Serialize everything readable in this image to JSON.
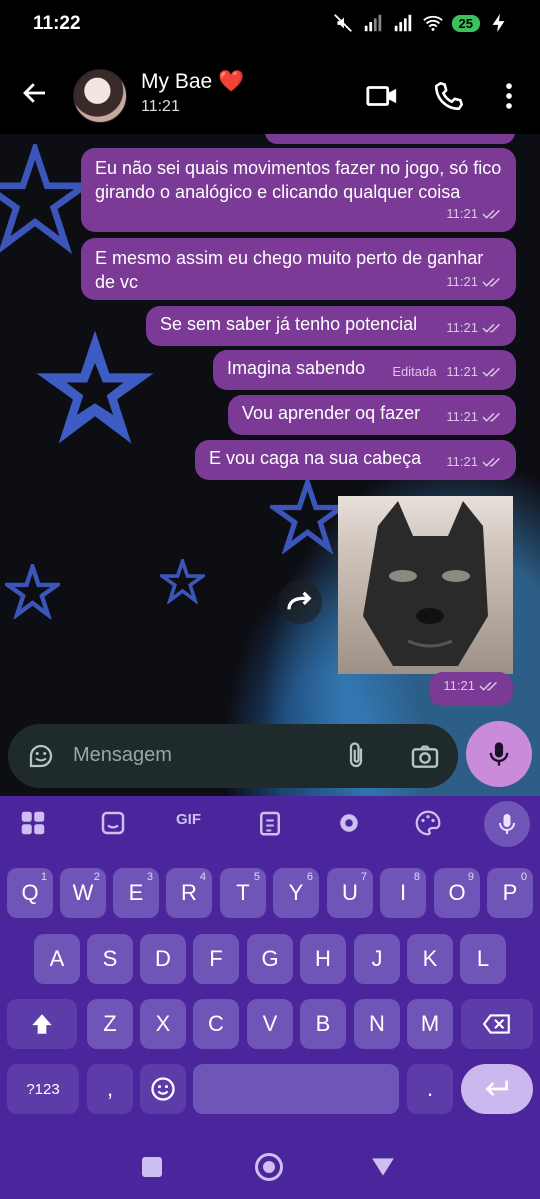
{
  "status": {
    "time": "11:22",
    "battery": "25"
  },
  "header": {
    "name": "My Bae ❤️",
    "subtitle": "11:21"
  },
  "messages": [
    {
      "text": "Eu não sei quais movimentos fazer no jogo, só fico girando o analógico e clicando qualquer coisa",
      "time": "11:21",
      "edited": ""
    },
    {
      "text": "E mesmo assim eu chego muito perto de ganhar de vc",
      "time": "11:21",
      "edited": ""
    },
    {
      "text": "Se sem saber já tenho potencial",
      "time": "11:21",
      "edited": ""
    },
    {
      "text": "Imagina sabendo",
      "time": "11:21",
      "edited": "Editada"
    },
    {
      "text": "Vou aprender oq fazer",
      "time": "11:21",
      "edited": ""
    },
    {
      "text": "E vou caga na sua cabeça",
      "time": "11:21",
      "edited": ""
    },
    {
      "text": "",
      "time": "11:21",
      "edited": ""
    }
  ],
  "input": {
    "placeholder": "Mensagem"
  },
  "keyboard": {
    "toolbar": [
      "apps-icon",
      "sticker-icon",
      "gif",
      "clipboard-icon",
      "settings-icon",
      "palette-icon",
      "mic-icon"
    ],
    "gif_label": "GIF",
    "row1": [
      {
        "k": "Q",
        "n": "1"
      },
      {
        "k": "W",
        "n": "2"
      },
      {
        "k": "E",
        "n": "3"
      },
      {
        "k": "R",
        "n": "4"
      },
      {
        "k": "T",
        "n": "5"
      },
      {
        "k": "Y",
        "n": "6"
      },
      {
        "k": "U",
        "n": "7"
      },
      {
        "k": "I",
        "n": "8"
      },
      {
        "k": "O",
        "n": "9"
      },
      {
        "k": "P",
        "n": "0"
      }
    ],
    "row2": [
      "A",
      "S",
      "D",
      "F",
      "G",
      "H",
      "J",
      "K",
      "L"
    ],
    "row3": [
      "Z",
      "X",
      "C",
      "V",
      "B",
      "N",
      "M"
    ],
    "sym": "?123",
    "comma": ",",
    "period": "."
  },
  "colors": {
    "bubble": "#7a3a96",
    "keyboard": "#4b259b",
    "key": "#7055b8",
    "mic": "#c98bda"
  }
}
